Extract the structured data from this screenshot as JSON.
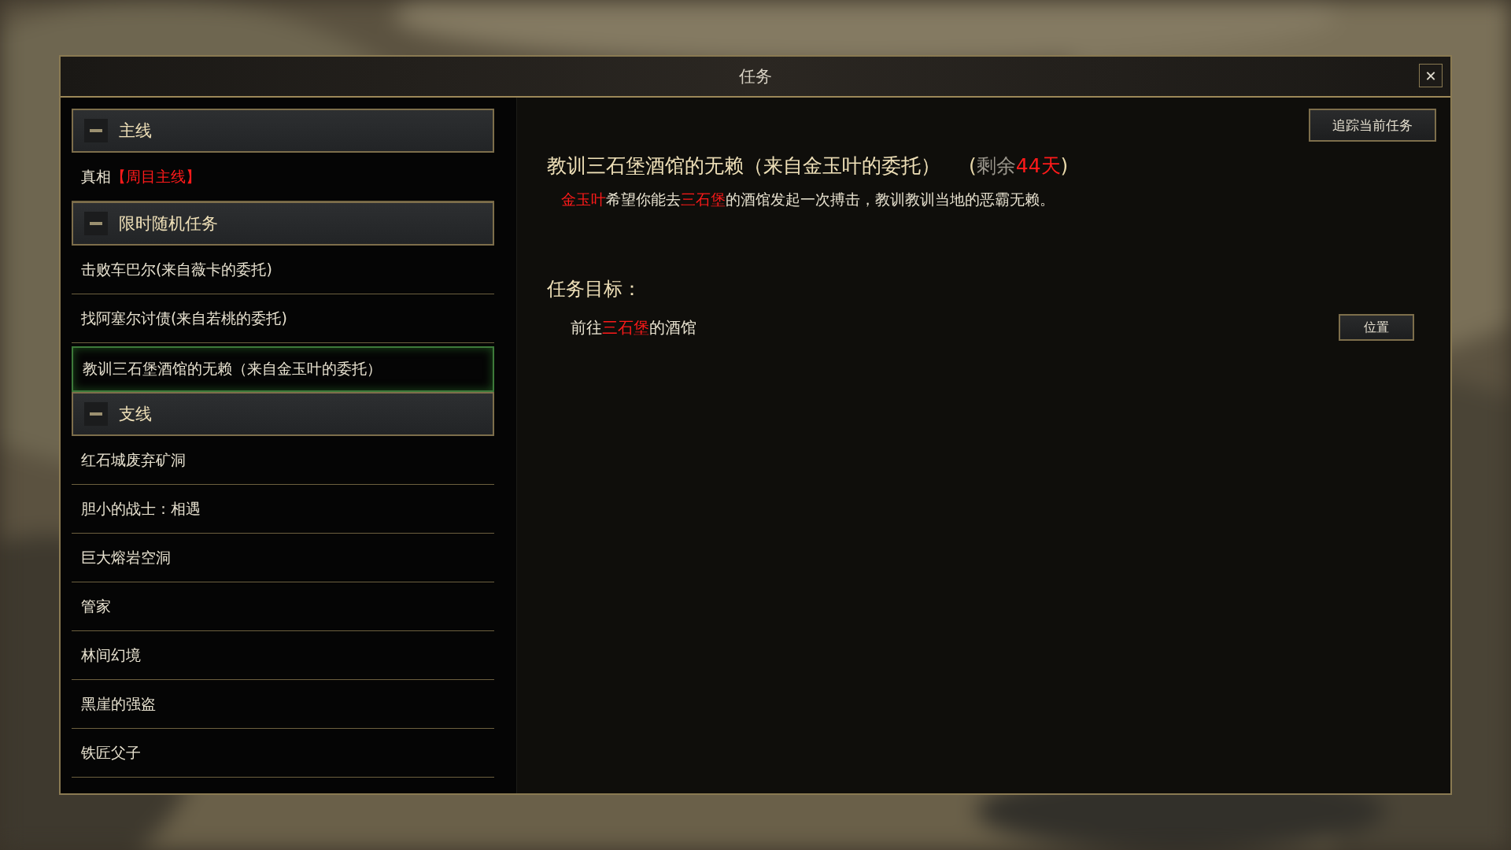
{
  "window": {
    "title": "任务",
    "close": "✕"
  },
  "sidebar": {
    "groups": [
      {
        "label": "主线",
        "expanded": true,
        "items": [
          {
            "parts": [
              {
                "text": "真相",
                "color": "#e8e2d0"
              },
              {
                "text": "【周目主线】",
                "color": "#ff1a1a"
              }
            ],
            "selected": false
          }
        ]
      },
      {
        "label": "限时随机任务",
        "expanded": true,
        "items": [
          {
            "label": "击败车巴尔(来自薇卡的委托)",
            "selected": false
          },
          {
            "label": "找阿塞尔讨债(来自若桃的委托)",
            "selected": false
          },
          {
            "label": "教训三石堡酒馆的无赖（来自金玉叶的委托）",
            "selected": true
          }
        ]
      },
      {
        "label": "支线",
        "expanded": true,
        "items": [
          {
            "label": "红石城废弃矿洞",
            "selected": false
          },
          {
            "label": "胆小的战士：相遇",
            "selected": false
          },
          {
            "label": "巨大熔岩空洞",
            "selected": false
          },
          {
            "label": "管家",
            "selected": false
          },
          {
            "label": "林间幻境",
            "selected": false
          },
          {
            "label": "黑崖的强盗",
            "selected": false
          },
          {
            "label": "铁匠父子",
            "selected": false
          }
        ]
      }
    ]
  },
  "detail": {
    "track_button": "追踪当前任务",
    "title": "教训三石堡酒馆的无赖（来自金玉叶的委托）",
    "remaining": [
      {
        "text": "(",
        "color": "#e6d6a8"
      },
      {
        "text": "剩余",
        "color": "#9a968c"
      },
      {
        "text": "44天",
        "color": "#ff1a1a"
      },
      {
        "text": ")",
        "color": "#e6d6a8"
      }
    ],
    "description": [
      {
        "text": "金玉叶",
        "color": "#ff1a1a"
      },
      {
        "text": "希望你能去",
        "color": "#e8e2d0"
      },
      {
        "text": "三石堡",
        "color": "#ff1a1a"
      },
      {
        "text": "的酒馆发起一次搏击，教训教训当地的恶霸无赖。",
        "color": "#e8e2d0"
      }
    ],
    "objectives_heading": "任务目标：",
    "objectives": [
      {
        "parts": [
          {
            "text": "前往",
            "color": "#e8e2d0"
          },
          {
            "text": "三石堡",
            "color": "#ff1a1a"
          },
          {
            "text": "的酒馆",
            "color": "#e8e2d0"
          }
        ],
        "button": "位置"
      }
    ]
  }
}
